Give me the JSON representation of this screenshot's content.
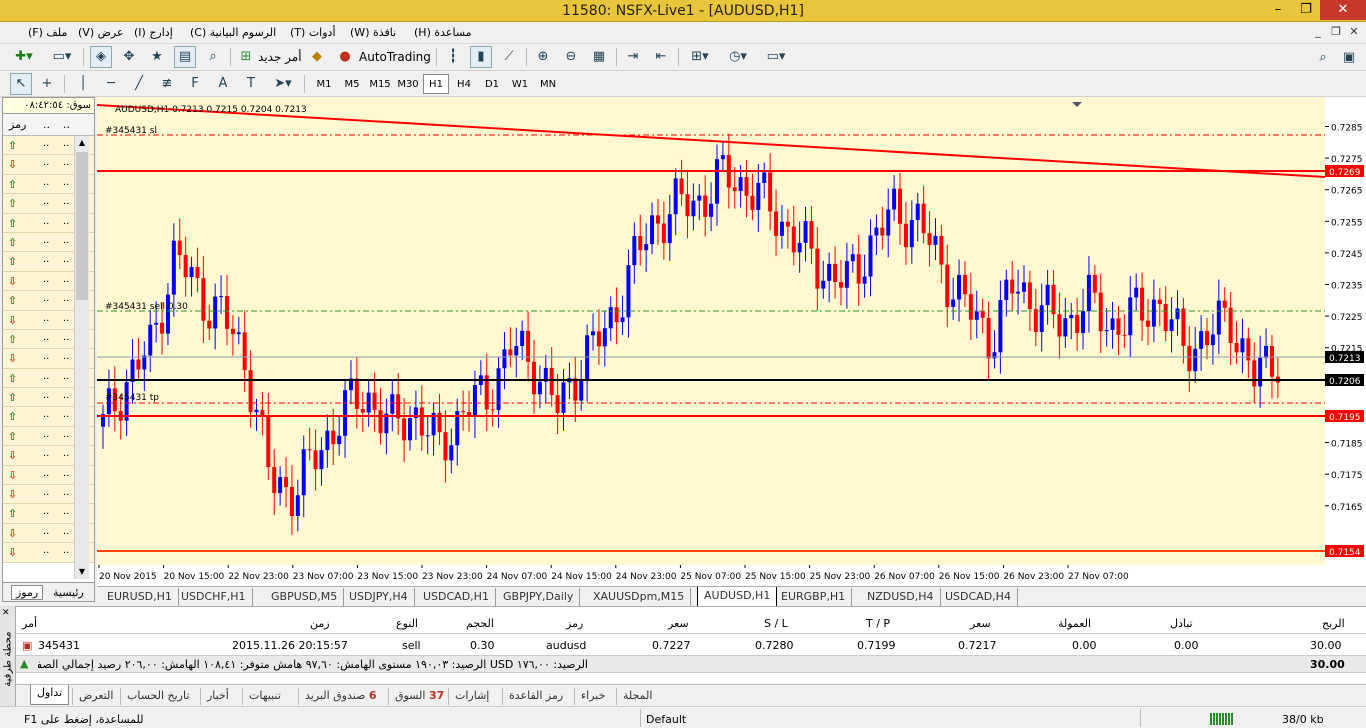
{
  "window": {
    "title": "11580: NSFX-Live1 - [AUDUSD,H1]",
    "min": "–",
    "restore": "❐",
    "close": "✕"
  },
  "menu": [
    "ملف (F)",
    "عرض (V)",
    "إدارج (I)",
    "الرسوم البيانية (C)",
    "أدوات (T)",
    "نافذة (W)",
    "مساعدة (H)"
  ],
  "toolbar": {
    "new_order": "أمر جديد",
    "autotrading": "AutoTrading"
  },
  "timeframes": [
    "M1",
    "M5",
    "M15",
    "M30",
    "H1",
    "H4",
    "D1",
    "W1",
    "MN"
  ],
  "active_tf": "H1",
  "market_watch": {
    "header": "سوق: ٠٨:٤٢:٥٤",
    "col_symbol": "رمز",
    "dots": "..",
    "tab_symbols": "رموز",
    "tab_main": "رئيسية",
    "rows": [
      "up",
      "down",
      "up",
      "up",
      "up",
      "up",
      "up",
      "down",
      "up",
      "down",
      "up",
      "down",
      "up",
      "up",
      "up",
      "up",
      "down",
      "down",
      "down",
      "up",
      "down",
      "down"
    ]
  },
  "chart": {
    "info": "AUDUSD,H1  0.7213 0.7215 0.7204 0.7213",
    "sl_label": "#345431 sl",
    "sell_label": "#345431 sell 0.30",
    "tp_label": "#345431 tp",
    "xticks": [
      "20 Nov 2015",
      "20 Nov 15:00",
      "22 Nov 23:00",
      "23 Nov 07:00",
      "23 Nov 15:00",
      "23 Nov 23:00",
      "24 Nov 07:00",
      "24 Nov 15:00",
      "24 Nov 23:00",
      "25 Nov 07:00",
      "25 Nov 15:00",
      "25 Nov 23:00",
      "26 Nov 07:00",
      "26 Nov 15:00",
      "26 Nov 23:00",
      "27 Nov 07:00"
    ],
    "yticks": [
      "0.7285",
      "0.7275",
      "0.7265",
      "0.7255",
      "0.7245",
      "0.7235",
      "0.7225",
      "0.7215",
      "0.7185",
      "0.7175",
      "0.7165"
    ],
    "price_tags": [
      {
        "v": "0.7269",
        "kind": "red"
      },
      {
        "v": "0.7213",
        "kind": "black"
      },
      {
        "v": "0.7206",
        "kind": "black"
      },
      {
        "v": "0.7195",
        "kind": "red"
      },
      {
        "v": "0.7154",
        "kind": "red"
      }
    ],
    "colors": {
      "bg": "#fff8d0",
      "bull": "#0000ff",
      "bear": "#ff0000",
      "line": "#ff0000"
    }
  },
  "chart_tabs": [
    "EURUSD,H1",
    "USDCHF,H1",
    "GBPUSD,M5",
    "USDJPY,H4",
    "USDCAD,H1",
    "GBPJPY,Daily",
    "XAUUSDpm,M15",
    "AUDUSD,H1",
    "EURGBP,H1",
    "NZDUSD,H4",
    "USDCAD,H4"
  ],
  "active_chart_tab": "AUDUSD,H1",
  "terminal": {
    "side_label": "محطة طرفية",
    "headers": {
      "order": "أمر",
      "time": "زمن",
      "type": "النوع",
      "volume": "الحجم",
      "symbol": "رمز",
      "price": "سعر",
      "sl": "S / L",
      "tp": "T / P",
      "price2": "سعر",
      "commission": "العمولة",
      "swap": "تبادل",
      "profit": "الربح"
    },
    "row": {
      "order": "345431",
      "time": "2015.11.26 20:15:57",
      "type": "sell",
      "volume": "0.30",
      "symbol": "audusd",
      "price": "0.7227",
      "sl": "0.7280",
      "tp": "0.7199",
      "price2": "0.7217",
      "commission": "0.00",
      "swap": "0.00",
      "profit": "30.00"
    },
    "balance_line": "الرصيد: ١٧٦,٠٠ USD  الرصيد: ١٩٠,٠٣  مستوى الهامش: ٩٧,٦٠  هامش متوفر: ١٠٨,٤١  الهامش: ٢٠٦,٠٠  رصيد إجمالي الصفقات: %",
    "balance_profit": "30.00",
    "tabs": [
      "تداول",
      "التعرض",
      "تاريخ الحساب",
      "أخبار",
      "تنبيهات",
      "صندوق البريد",
      "السوق",
      "إشارات",
      "رمز القاعدة",
      "خبراء",
      "المجلة"
    ],
    "mail_count": "6",
    "market_count": "37"
  },
  "status": {
    "help": "للمساعدة، إضغط على F1",
    "profile": "Default",
    "traffic": "38/0 kb"
  }
}
